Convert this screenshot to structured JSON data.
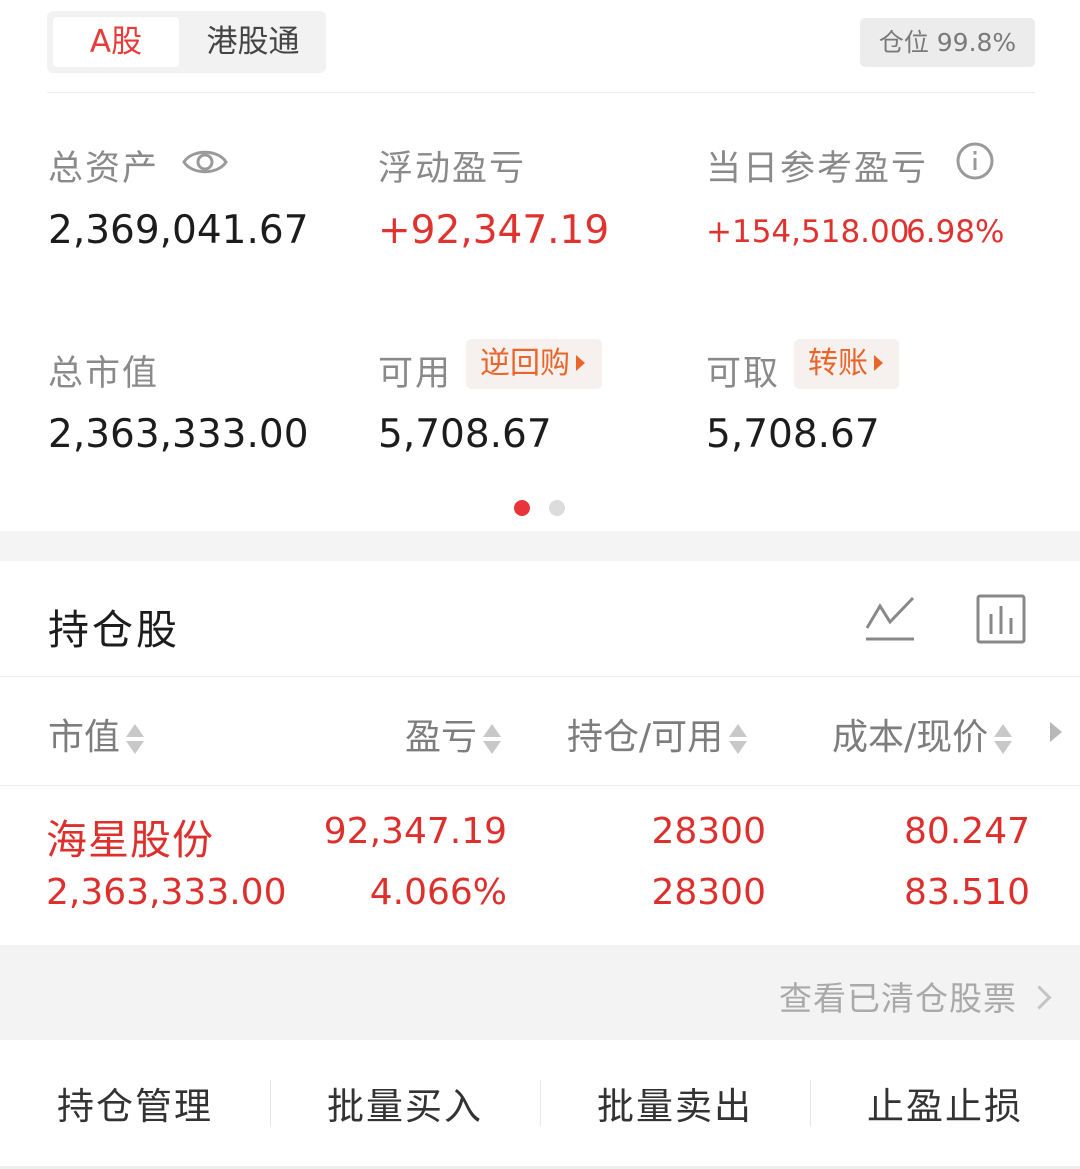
{
  "tabs": {
    "a_shares": "A股",
    "hk_connect": "港股通"
  },
  "position_ratio": "仓位 99.8%",
  "summary": {
    "total_assets": {
      "label": "总资产",
      "value": "2,369,041.67"
    },
    "floating_pl": {
      "label": "浮动盈亏",
      "value": "+92,347.19"
    },
    "daily_pl": {
      "label": "当日参考盈亏",
      "value": "+154,518.00",
      "percent": "6.98%"
    },
    "market_value": {
      "label": "总市值",
      "value": "2,363,333.00"
    },
    "available": {
      "label": "可用",
      "value": "5,708.67",
      "action": "逆回购"
    },
    "withdrawable": {
      "label": "可取",
      "value": "5,708.67",
      "action": "转账"
    }
  },
  "pager": {
    "count": 2,
    "active": 1
  },
  "holdings": {
    "title": "持仓股",
    "columns": [
      "市值",
      "盈亏",
      "持仓/可用",
      "成本/现价"
    ],
    "rows": [
      {
        "name": "海星股份",
        "market_value": "2,363,333.00",
        "pl": "92,347.19",
        "pl_pct": "4.066%",
        "position": "28300",
        "available": "28300",
        "cost": "80.247",
        "price": "83.510"
      }
    ],
    "cleared_link": "查看已清仓股票"
  },
  "bottom_actions": [
    "持仓管理",
    "批量买入",
    "批量卖出",
    "止盈止损"
  ],
  "colors": {
    "accent_red": "#e0322f",
    "orange": "#e8662c",
    "muted": "#8a8a8a"
  }
}
